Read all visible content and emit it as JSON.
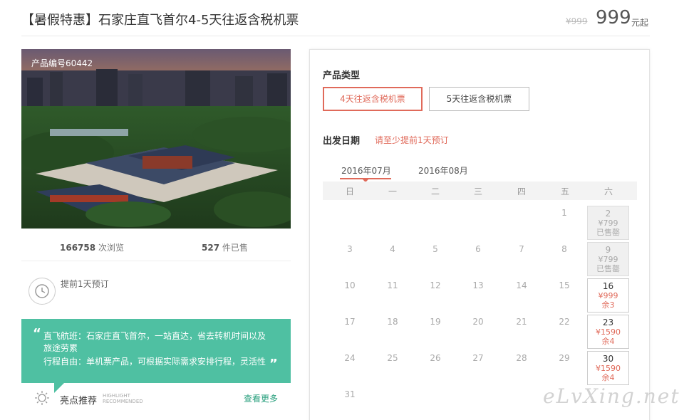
{
  "header": {
    "title": "【暑假特惠】石家庄直飞首尔4-5天往返含税机票",
    "old_price": "¥999",
    "price": "999",
    "price_unit": "元起"
  },
  "photo": {
    "code": "产品编号60442"
  },
  "stats": {
    "views": "166758",
    "views_label": "次浏览",
    "sold": "527",
    "sold_label": "件已售"
  },
  "advance": {
    "text": "提前1天预订"
  },
  "highlight": {
    "line1": "直飞航班：石家庄直飞首尔，一站直达，省去转机时间以及旅途劳累",
    "line2": "行程自由：单机票产品，可根据实际需求安排行程，灵活性",
    "title": "亮点推荐",
    "title_en": "HIGHLIGHT RECOMMENDED",
    "more": "查看更多"
  },
  "booking": {
    "type_label": "产品类型",
    "options": [
      "4天往返含税机票",
      "5天往返含税机票"
    ],
    "date_label": "出发日期",
    "date_note": "请至少提前1天预订",
    "months": [
      "2016年07月",
      "2016年08月"
    ],
    "weekdays": [
      "日",
      "一",
      "二",
      "三",
      "四",
      "五",
      "六"
    ],
    "rows": [
      [
        "",
        "",
        "",
        "",
        "",
        "1",
        "2"
      ],
      [
        "3",
        "4",
        "5",
        "6",
        "7",
        "8",
        "9"
      ],
      [
        "10",
        "11",
        "12",
        "13",
        "14",
        "15",
        "16"
      ],
      [
        "17",
        "18",
        "19",
        "20",
        "21",
        "22",
        "23"
      ],
      [
        "24",
        "25",
        "26",
        "27",
        "28",
        "29",
        "30"
      ],
      [
        "31"
      ]
    ],
    "saturdays": [
      {
        "day": "2",
        "price": "¥799",
        "status": "已售罄"
      },
      {
        "day": "9",
        "price": "¥799",
        "status": "已售罄"
      },
      {
        "day": "16",
        "price": "¥999",
        "status": "余3"
      },
      {
        "day": "23",
        "price": "¥1590",
        "status": "余4"
      },
      {
        "day": "30",
        "price": "¥1590",
        "status": "余4"
      }
    ]
  },
  "watermark": "eLvXing.net"
}
